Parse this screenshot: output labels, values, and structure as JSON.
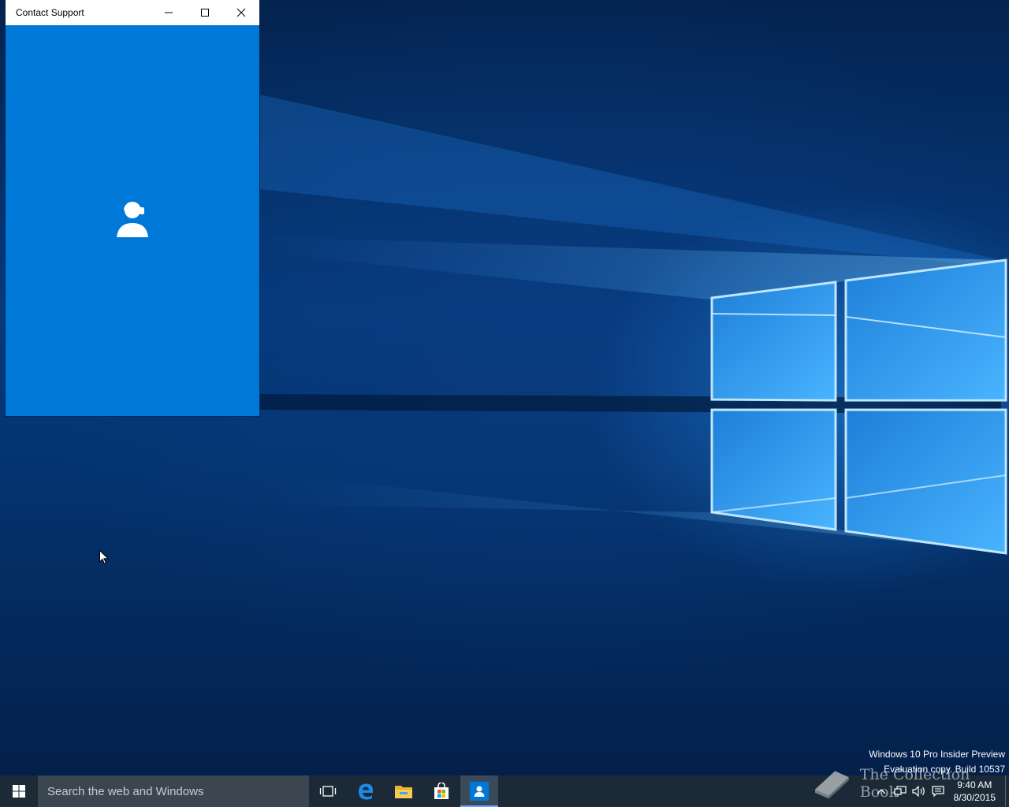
{
  "window": {
    "title": "Contact Support",
    "minimize_icon": "minimize-icon",
    "maximize_icon": "maximize-icon",
    "close_icon": "close-icon",
    "background_color": "#0078d7",
    "center_icon": "support-agent-icon"
  },
  "desktop": {
    "watermark_line1": "Windows 10 Pro Insider Preview",
    "watermark_line2": "Evaluation copy. Build 10537",
    "brand_text": "The Collection Book",
    "brand_icon": "book-icon"
  },
  "taskbar": {
    "search_placeholder": "Search the web and Windows",
    "icons": [
      "start-icon",
      "task-view-icon",
      "edge-icon",
      "file-explorer-icon",
      "store-icon",
      "contact-support-icon"
    ],
    "active_app": "Contact Support",
    "clock_time": "9:40 AM",
    "clock_date": "8/30/2015",
    "tray_icons": [
      "chevron-up-icon",
      "network-icon",
      "volume-icon",
      "action-center-icon"
    ]
  }
}
